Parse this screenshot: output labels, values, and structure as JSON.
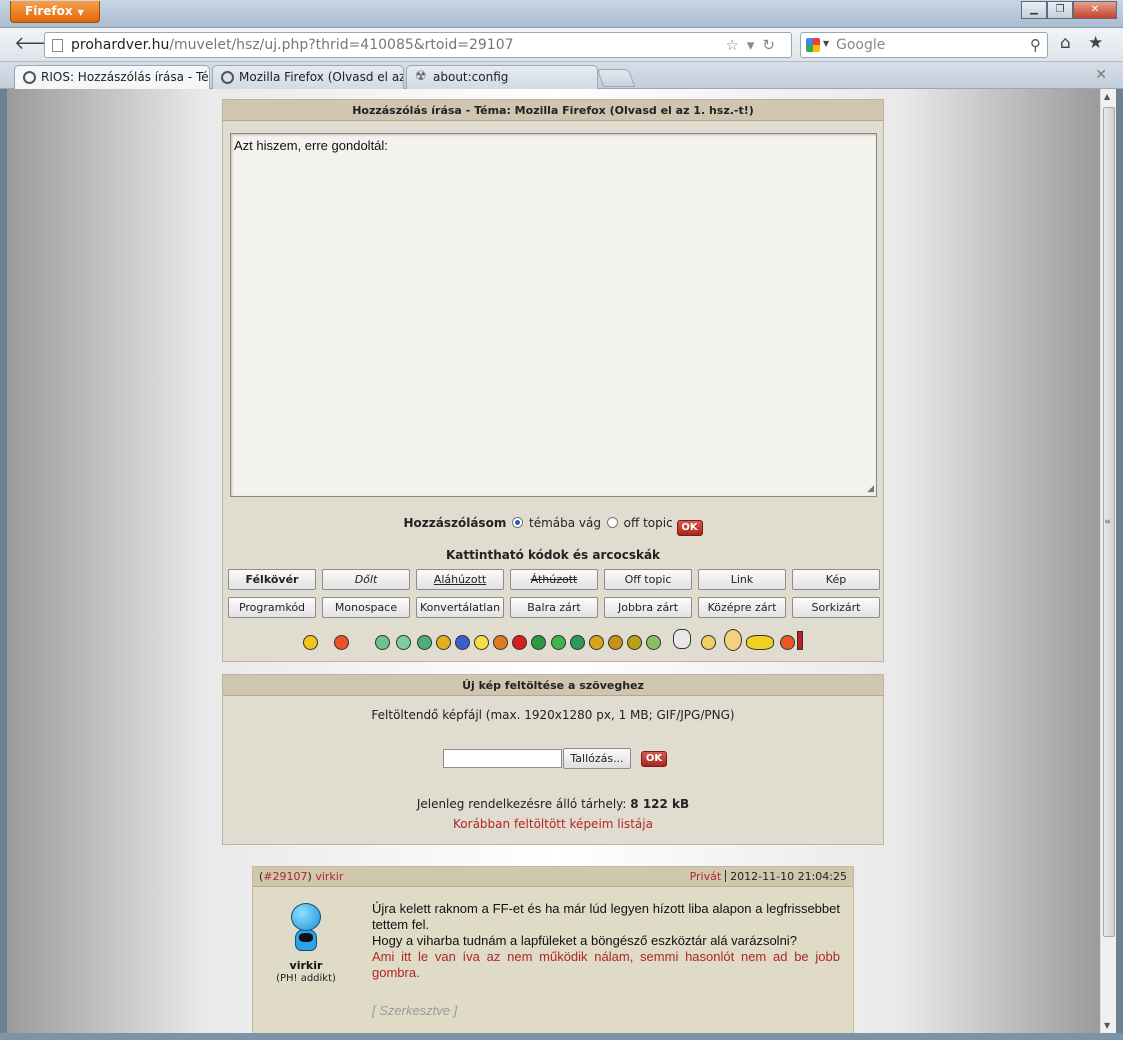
{
  "window": {
    "app_button": "Firefox",
    "controls": {
      "minimize": "▁",
      "maximize": "❐",
      "close": "✕"
    }
  },
  "nav": {
    "url_host": "prohardver.hu",
    "url_path": "/muvelet/hsz/uj.php?thrid=410085&rtoid=29107",
    "search_placeholder": "Google"
  },
  "tabs": [
    {
      "label": "RIOS: Hozzászólás írása - Té..."
    },
    {
      "label": "Mozilla Firefox (Olvasd el az ..."
    },
    {
      "label": "about:config"
    }
  ],
  "compose": {
    "heading": "Hozzászólás írása - Téma: Mozilla Firefox (Olvasd el az 1. hsz.-t!)",
    "text": "Azt hiszem, erre gondoltál:",
    "post_as_label": "Hozzászólásom",
    "option_on_topic": "témába vág",
    "option_off_topic": "off topic",
    "ok": "OK",
    "codes_title": "Kattintható kódok és arcocskák",
    "buttons_row1": [
      "Félkövér",
      "Dőlt",
      "Aláhúzott",
      "Áthúzott",
      "Off topic",
      "Link",
      "Kép"
    ],
    "buttons_row2": [
      "Programkód",
      "Monospace",
      "Konvertálatlan",
      "Balra zárt",
      "Jobbra zárt",
      "Középre zárt",
      "Sorkizárt"
    ]
  },
  "upload": {
    "heading": "Új kép feltöltése a szöveghez",
    "label": "Feltöltendő képfájl (max. 1920x1280 px, 1 MB; GIF/JPG/PNG)",
    "browse": "Tallózás...",
    "ok": "OK",
    "storage_label": "Jelenleg rendelkezésre álló tárhely:",
    "storage_value": "8 122 kB",
    "previous_link": "Korábban feltöltött képeim listája"
  },
  "post": {
    "id": "#29107",
    "author": "virkir",
    "private": "Privát",
    "datetime": "2012-11-10 21:04:25",
    "user_name": "virkir",
    "user_rank": "(PH! addikt)",
    "line1": "Újra kelett raknom a FF-et és ha már lúd legyen hízott liba alapon a legfrissebbet tettem fel.",
    "line2": "Hogy a viharba tudnám a lapfüleket a böngésző eszköztár alá varázsolni?",
    "line3": "Ami itt le van íva az nem működik nálam, semmi hasonlót nem ad be jobb gombra.",
    "edited": "[ Szerkesztve ]"
  }
}
